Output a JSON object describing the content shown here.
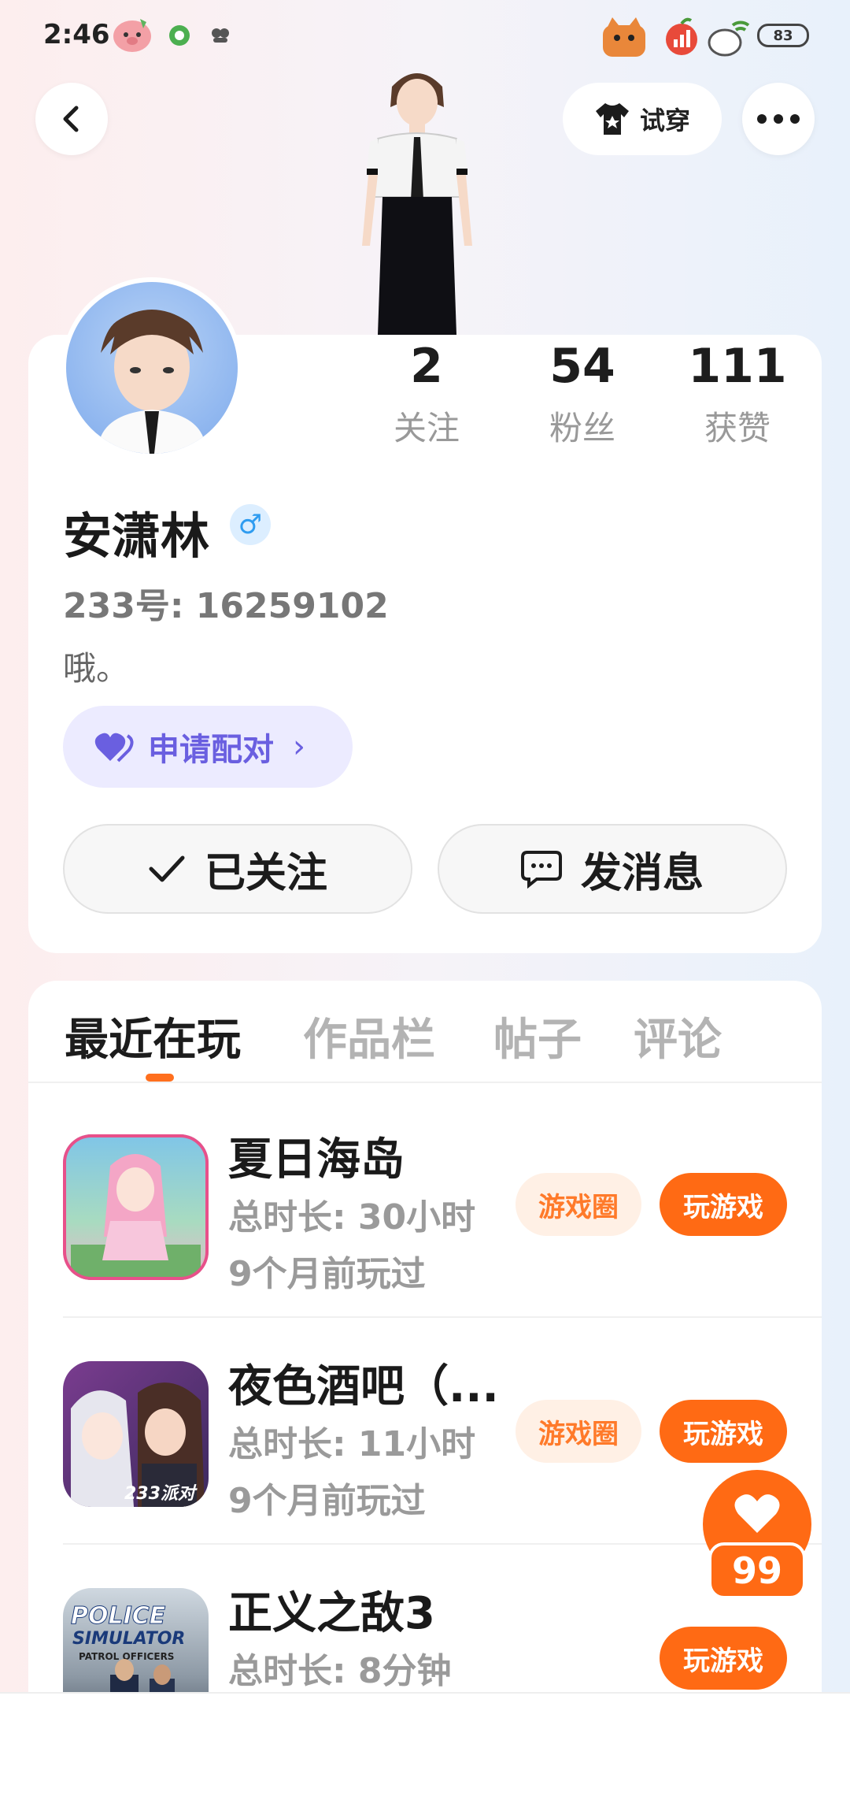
{
  "status_bar": {
    "time": "2:46",
    "battery": "83"
  },
  "nav": {
    "try_on_label": "试穿"
  },
  "profile": {
    "name": "安潇林",
    "gender_symbol": "♂",
    "uid": "233号: 16259102",
    "bio": "哦。",
    "pair_label": "申请配对",
    "pair_chevron": "›",
    "stats": [
      {
        "num": "2",
        "label": "关注"
      },
      {
        "num": "54",
        "label": "粉丝"
      },
      {
        "num": "111",
        "label": "获赞"
      }
    ],
    "follow_label": "已关注",
    "message_label": "发消息"
  },
  "tabs": [
    {
      "label": "最近在玩"
    },
    {
      "label": "作品栏"
    },
    {
      "label": "帖子"
    },
    {
      "label": "评论"
    }
  ],
  "games": [
    {
      "title": "夏日海岛",
      "duration": "总时长: 30小时",
      "last_played": "9个月前玩过",
      "circle_label": "游戏圈",
      "play_label": "玩游戏"
    },
    {
      "title": "夜色酒吧（...",
      "duration": "总时长: 11小时",
      "last_played": "9个月前玩过",
      "circle_label": "游戏圈",
      "play_label": "玩游戏",
      "thumb_badge": "233派对"
    },
    {
      "title": "正义之敌3",
      "duration": "总时长: 8分钟",
      "play_label": "玩游戏",
      "thumb_text_1": "POLICE",
      "thumb_text_2": "SIMULATOR",
      "thumb_text_3": "PATROL OFFICERS"
    }
  ],
  "like": {
    "count": "99"
  },
  "colors": {
    "accent": "#ff6a14",
    "pair": "#6a5fe0",
    "gender": "#2f9cf0"
  }
}
